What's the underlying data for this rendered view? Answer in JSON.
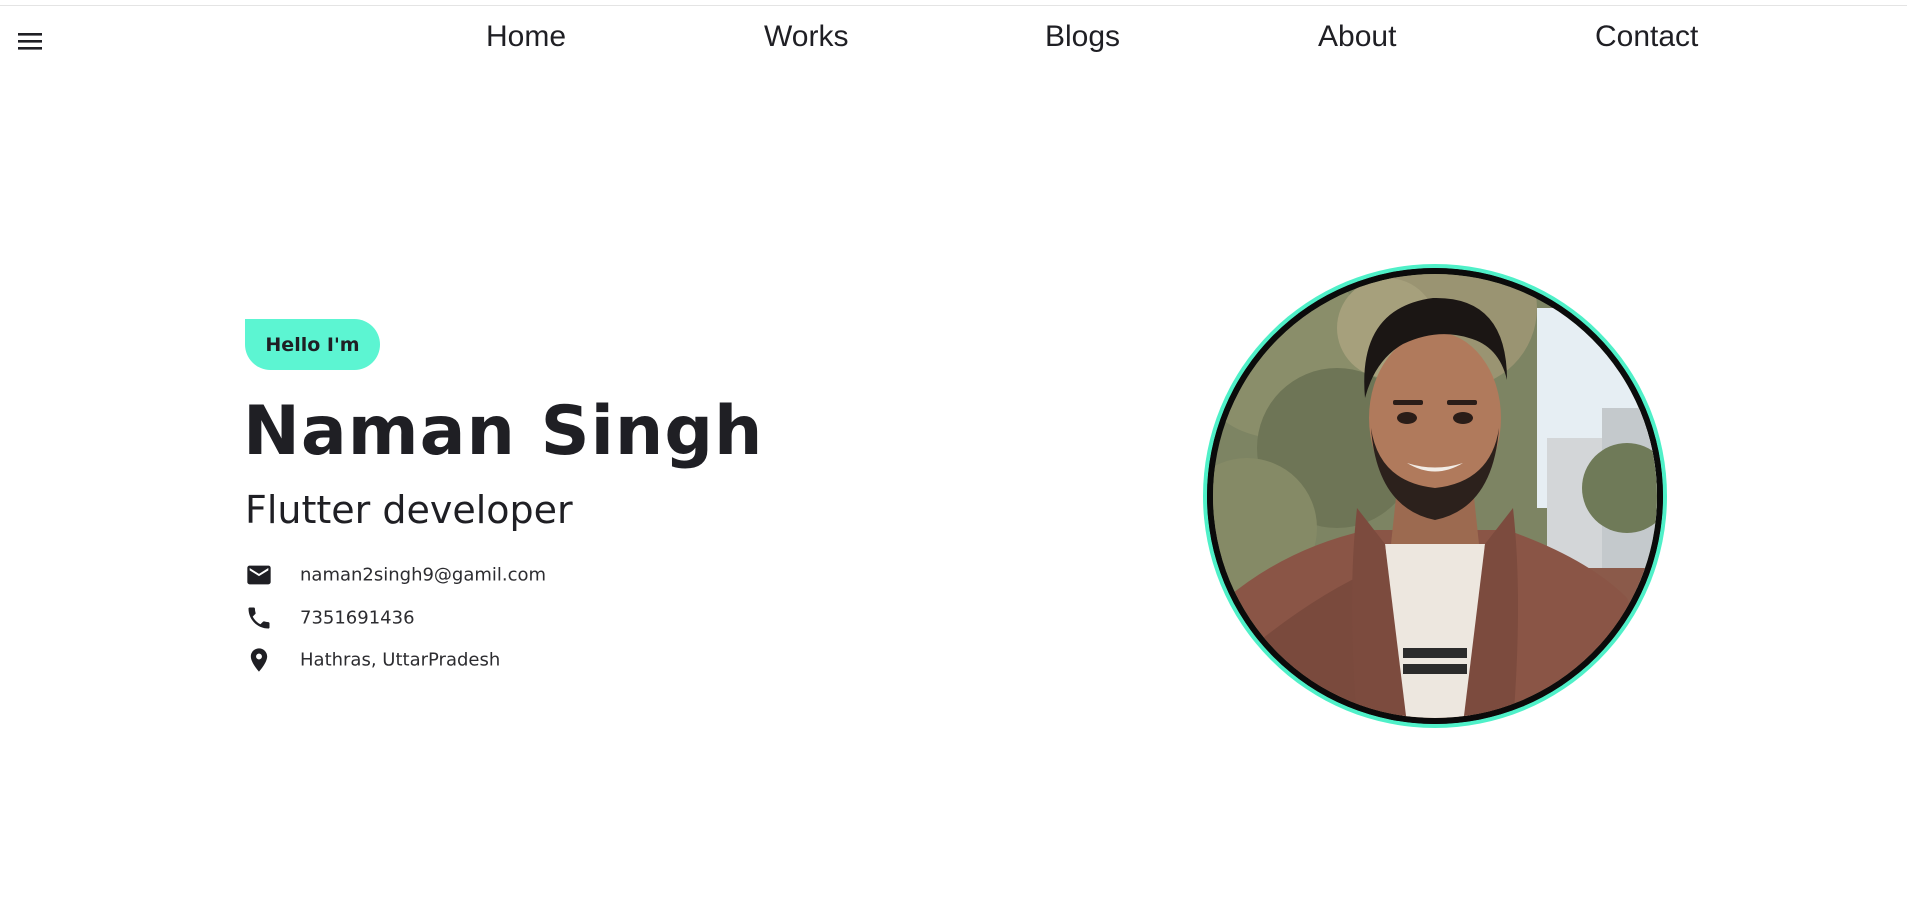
{
  "nav": {
    "menu_icon": "hamburger-menu-icon",
    "items": [
      {
        "label": "Home"
      },
      {
        "label": "Works"
      },
      {
        "label": "Blogs"
      },
      {
        "label": "About"
      },
      {
        "label": "Contact"
      }
    ]
  },
  "hero": {
    "greeting": "Hello I'm",
    "name": "Naman Singh",
    "role": "Flutter developer",
    "contacts": [
      {
        "icon": "email-icon",
        "text": "naman2singh9@gamil.com"
      },
      {
        "icon": "phone-icon",
        "text": "7351691436"
      },
      {
        "icon": "location-pin-icon",
        "text": "Hathras, UttarPradesh"
      }
    ]
  },
  "colors": {
    "accent": "#5cf5d2",
    "text": "#1f1f24",
    "background": "#ffffff"
  }
}
